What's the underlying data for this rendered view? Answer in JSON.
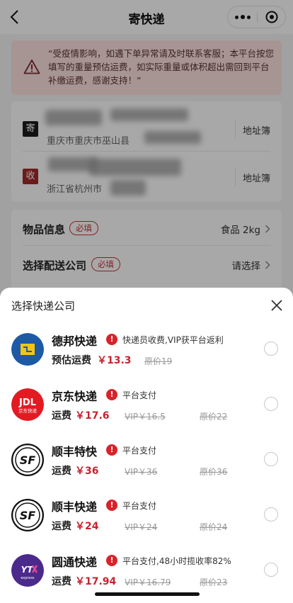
{
  "nav": {
    "title": "寄快递"
  },
  "notice": {
    "text": "“受疫情影响，如遇下单异常请及时联系客服；本平台按您填写的重量预估运费，如实际重量或体积超出需回到平台补缴运费，感谢支持！”"
  },
  "sender": {
    "badge": "寄",
    "region": "重庆市重庆市巫山县",
    "address_book": "地址簿"
  },
  "receiver": {
    "badge": "收",
    "region": "浙江省杭州市",
    "address_book": "地址簿"
  },
  "form": {
    "item_info": {
      "label": "物品信息",
      "required": "必填",
      "value": "食品 2kg"
    },
    "courier_select": {
      "label": "选择配送公司",
      "required": "必填",
      "value": "请选择"
    }
  },
  "sheet": {
    "title": "选择快递公司",
    "couriers": [
      {
        "name": "德邦快递",
        "note": "快递员收费,VIP获平台返利",
        "fee_label": "预估运费",
        "fee": "￥13.3",
        "vip": "",
        "original": "原价19",
        "logo": "deppon-logo",
        "brand_color": "#1d5aa6"
      },
      {
        "name": "京东快递",
        "note": "平台支付",
        "fee_label": "运费",
        "fee": "￥17.6",
        "vip": "VIP￥16.5",
        "original": "原价22",
        "logo": "jdl-logo",
        "logo_text": "JDL",
        "logo_subtext": "京东快递",
        "brand_color": "#e21b23"
      },
      {
        "name": "顺丰特快",
        "note": "平台支付",
        "fee_label": "运费",
        "fee": "￥36",
        "vip": "VIP￥36",
        "original": "原价36",
        "logo": "sf-logo",
        "logo_text": "SF",
        "brand_color": "#111111"
      },
      {
        "name": "顺丰快递",
        "note": "平台支付",
        "fee_label": "运费",
        "fee": "￥24",
        "vip": "VIP￥24",
        "original": "原价24",
        "logo": "sf-logo",
        "logo_text": "SF",
        "brand_color": "#111111"
      },
      {
        "name": "圆通快递",
        "note": "平台支付,48小时揽收率82%",
        "fee_label": "运费",
        "fee": "￥17.94",
        "vip": "VIP￥16.79",
        "original": "原价23",
        "logo": "yto-logo",
        "logo_text": "YTO",
        "brand_color": "#4b2a8c"
      }
    ]
  },
  "colors": {
    "accent_red": "#c7232f",
    "notice_bg": "#fce2e0"
  }
}
